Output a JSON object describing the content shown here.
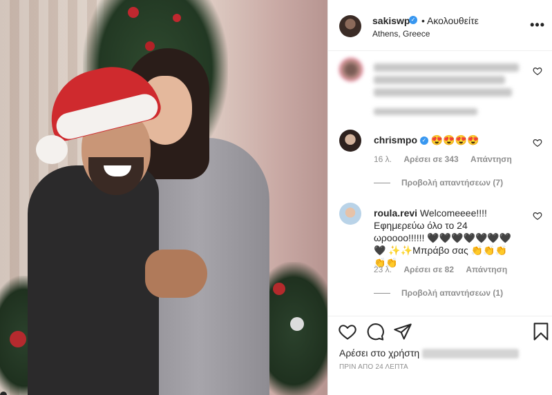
{
  "header": {
    "username": "sakiswp",
    "verified_glyph": "✓",
    "follow_text": "• Ακολουθείτε",
    "location": "Athens, Greece",
    "more_glyph": "•••"
  },
  "comments": [
    {
      "avatar": "blurred-avatar",
      "blurred": true,
      "meta_likes": "",
      "replies": ""
    },
    {
      "user": "chrismpo",
      "verified": true,
      "text": "😍😍😍😍",
      "time": "16 λ.",
      "likes": "Αρέσει σε 343",
      "reply": "Απάντηση",
      "view_replies": "Προβολή απαντήσεων (7)"
    },
    {
      "user": "roula.revi",
      "text": "Welcomeeee!!!! Εφημερεύω όλο το 24 ωροοοο!!!!!! 🖤🖤🖤🖤🖤🖤🖤🖤 ✨✨Μπράβο σας 👏👏👏👏👏",
      "time": "23 λ.",
      "likes": "Αρέσει σε 82",
      "reply": "Απάντηση",
      "view_replies": "Προβολή απαντήσεων (1)"
    }
  ],
  "actions": {
    "liked_by_prefix": "Αρέσει στο χρήστη",
    "timestamp": "ΠΡΙΝ ΑΠΟ 24 ΛΕΠΤΑ",
    "icons": [
      "heart-icon",
      "comment-icon",
      "share-icon",
      "bookmark-icon"
    ]
  },
  "colors": {
    "text": "#262626",
    "muted": "#8e8e8e",
    "verified": "#3897f0",
    "border": "#efefef"
  }
}
